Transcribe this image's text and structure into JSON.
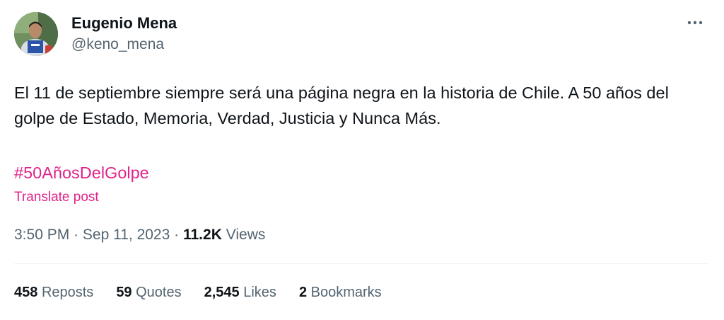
{
  "author": {
    "display_name": "Eugenio Mena",
    "handle": "@keno_mena"
  },
  "post": {
    "text": "El 11 de septiembre siempre será una página negra en la historia de Chile. A 50 años del golpe de Estado, Memoria, Verdad, Justicia y Nunca Más.",
    "hashtag": "#50AñosDelGolpe",
    "translate_label": "Translate post"
  },
  "meta": {
    "time": "3:50 PM",
    "separator": "·",
    "date": "Sep 11, 2023",
    "views_count": "11.2K",
    "views_label": "Views"
  },
  "stats": {
    "reposts": {
      "count": "458",
      "label": "Reposts"
    },
    "quotes": {
      "count": "59",
      "label": "Quotes"
    },
    "likes": {
      "count": "2,545",
      "label": "Likes"
    },
    "bookmarks": {
      "count": "2",
      "label": "Bookmarks"
    }
  },
  "icons": {
    "more": "more-horizontal-icon"
  },
  "colors": {
    "hashtag": "#e0248a",
    "text_primary": "#0f1419",
    "text_secondary": "#536471",
    "divider": "#eff3f4"
  }
}
